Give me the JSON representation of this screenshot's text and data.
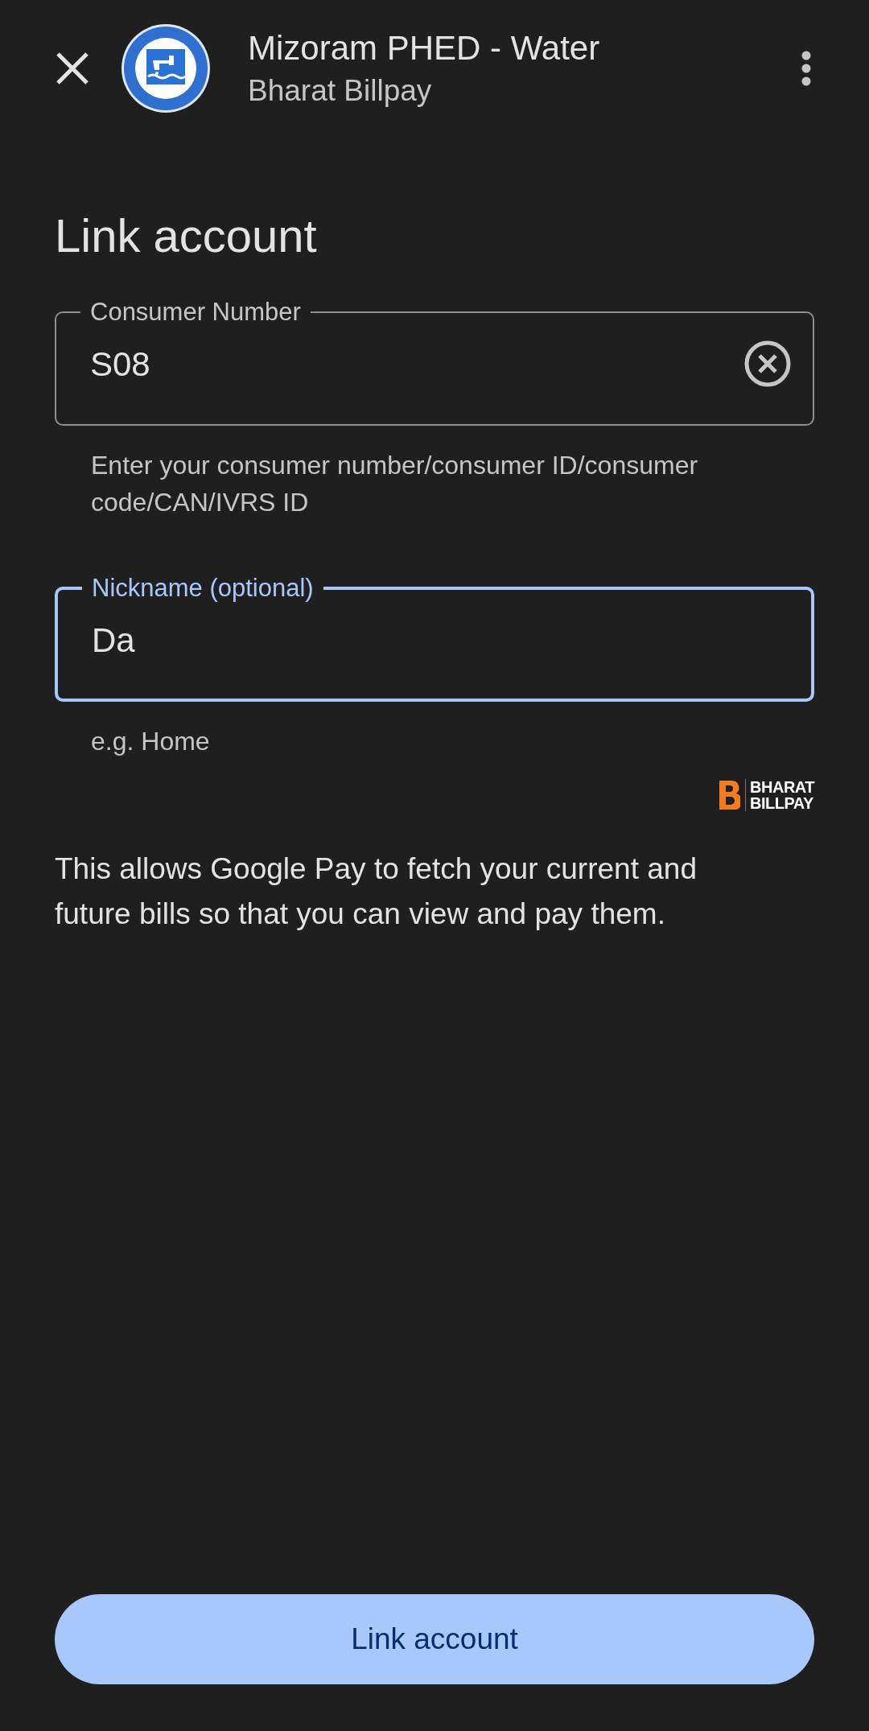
{
  "header": {
    "title": "Mizoram PHED - Water",
    "subtitle": "Bharat Billpay"
  },
  "heading": "Link account",
  "fields": [
    {
      "label": "Consumer Number",
      "value": "S08",
      "focused": false,
      "clearable": true,
      "helper": "Enter your consumer number/consumer ID/consumer code/CAN/IVRS ID"
    },
    {
      "label": "Nickname (optional)",
      "value": "Da",
      "focused": true,
      "clearable": false,
      "helper": "e.g. Home"
    }
  ],
  "brand": {
    "line_1": "BHARAT",
    "line_2": "BILLPAY"
  },
  "description": "This allows Google Pay to fetch your current and future bills so that you can view and pay them.",
  "button": "Link account"
}
